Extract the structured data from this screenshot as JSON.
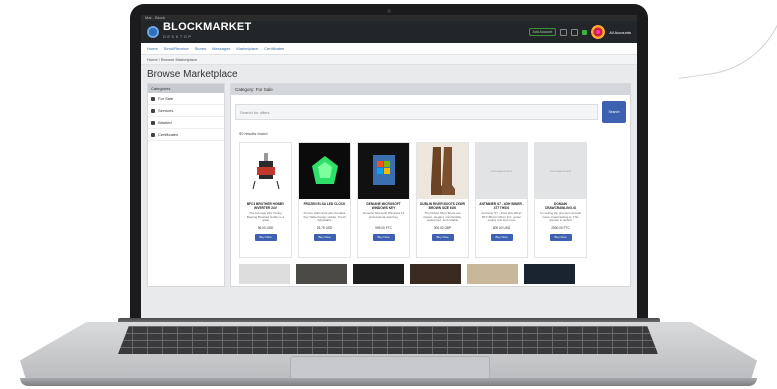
{
  "window": {
    "title": "Mai - Block"
  },
  "brand": {
    "name": "BLOCKMARKET",
    "tagline": "DESKTOP"
  },
  "topbar": {
    "login_label": "Add Account",
    "accounts_label": "All Accounts"
  },
  "nav": {
    "items": [
      {
        "label": "Home"
      },
      {
        "label": "Send/Receive"
      },
      {
        "label": "Stores"
      },
      {
        "label": "Messages"
      },
      {
        "label": "Marketplace"
      },
      {
        "label": "Certificates"
      }
    ]
  },
  "breadcrumb": "Home / Browse Marketplace",
  "page": {
    "title": "Browse Marketplace"
  },
  "sidebar": {
    "header": "Categories",
    "items": [
      {
        "label": "For Sale",
        "icon": "cart-icon"
      },
      {
        "label": "Services",
        "icon": "handshake-icon"
      },
      {
        "label": "Wanted",
        "icon": "heart-icon"
      },
      {
        "label": "Certificates",
        "icon": "certificate-icon"
      }
    ]
  },
  "main": {
    "header": "Category: For Sale",
    "search_placeholder": "Search for offers",
    "search_button": "Search",
    "results_label": "90 results found"
  },
  "products": [
    {
      "title": "BFC3 BROTHER HOBBY INVERTER 24V",
      "desc": "The Average 24V Timing Bearing Brushed Hobby is a great",
      "price": "96.00 USD",
      "button": "Buy Now",
      "thumb": "motor"
    },
    {
      "title": "FROZEN ELSA LED CLOCK",
      "desc": "Frozen LED clock plus the Elsa Toy/ Table Design Holder. Touch Adjustable",
      "price": "25.75 USD",
      "button": "Buy Now",
      "thumb": "green"
    },
    {
      "title": "GENUINE MICROSOFT WINDOWS KEY",
      "desc": "Genuine Microsoft Windows 10 professional retail key",
      "price": "999.00 FTC",
      "button": "Buy Now",
      "thumb": "key"
    },
    {
      "title": "DUBLIN RIVER BOOTS 2XWR BROWN SIZE 6UK",
      "desc": "The Dublin River Boots are classic, elegant, comfortable, waterproof, and reliable",
      "price": "300.00 GBP",
      "button": "Buy Now",
      "thumb": "boots"
    },
    {
      "title": "ANTMINER S7 - 4GH WINER - 477 THS/S",
      "desc": "Antminer S7 - 4GH 1kw Winer BTC Bitcoin Miner incl. power supply unit and more",
      "price": "800.00 USD",
      "button": "Buy Now",
      "thumb": "blank"
    },
    {
      "title": "DOMAIN CRAWCRAWLING.IO",
      "desc": "I'm selling the premium domain name crawcrawling.io. This domain is perfect",
      "price": "2500.00 FTC",
      "button": "Buy Now",
      "thumb": "blank"
    }
  ],
  "placeholder_text": "no image found"
}
